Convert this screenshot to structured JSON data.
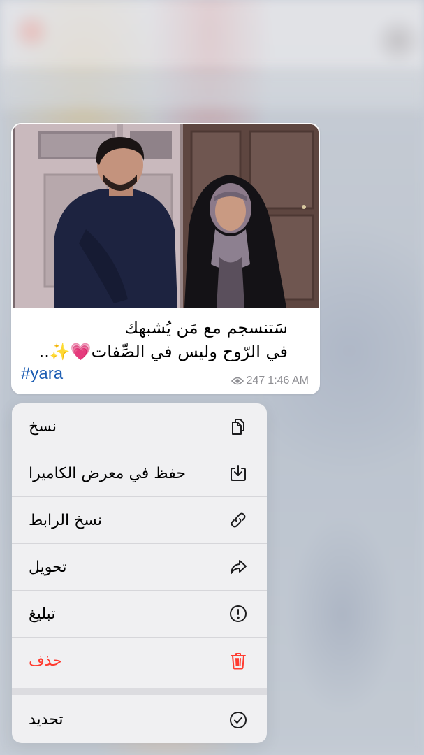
{
  "message": {
    "caption_lines": [
      "سَتنسجم مع مَن يُشبهك",
      "في الرّوح وليس في الصِّفات💗✨.."
    ],
    "hashtag": "#yara",
    "views": "247",
    "time": "1:46 AM",
    "photo_icon": "photo-couple-scene"
  },
  "menu": {
    "items": [
      {
        "label": "نسخ",
        "icon": "copy-icon"
      },
      {
        "label": "حفظ في معرض الكاميرا",
        "icon": "save-to-gallery-icon"
      },
      {
        "label": "نسخ الرابط",
        "icon": "link-icon"
      },
      {
        "label": "تحويل",
        "icon": "forward-icon"
      },
      {
        "label": "تبليغ",
        "icon": "report-icon"
      },
      {
        "label": "حذف",
        "icon": "trash-icon",
        "destructive": true
      },
      {
        "label": "تحديد",
        "icon": "checkmark-circle-icon"
      }
    ]
  },
  "colors": {
    "destructive": "#ff3b30",
    "hashtag": "#1f5fb4",
    "meta": "#8e8e93",
    "menu_background": "#f0f0f2"
  }
}
